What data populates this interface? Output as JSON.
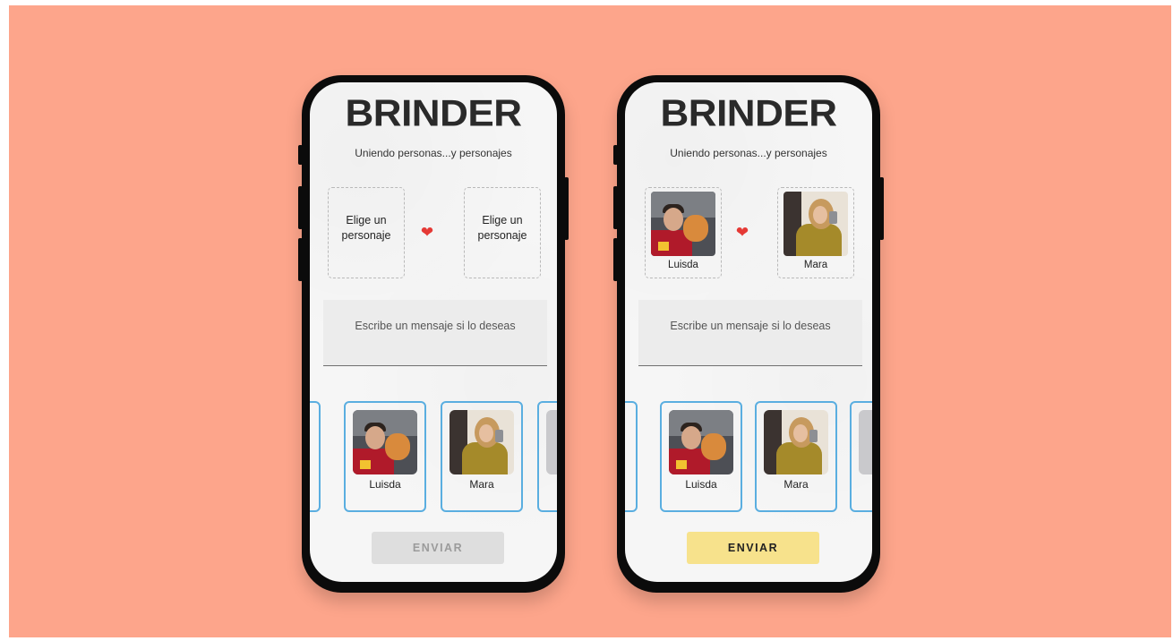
{
  "screens": [
    {
      "brand": "BRINDER",
      "tagline": "Uniendo personas...y personajes",
      "slot_left": {
        "text": "Elige un personaje",
        "name": "",
        "filled": false
      },
      "slot_right": {
        "text": "Elige un personaje",
        "name": "",
        "filled": false
      },
      "message_placeholder": "Escribe un mensaje si lo deseas",
      "cards": [
        {
          "name": "Luisda"
        },
        {
          "name": "Mara"
        }
      ],
      "send_label": "ENVIAR",
      "send_state": "disabled"
    },
    {
      "brand": "BRINDER",
      "tagline": "Uniendo personas...y personajes",
      "slot_left": {
        "text": "",
        "name": "Luisda",
        "filled": true
      },
      "slot_right": {
        "text": "",
        "name": "Mara",
        "filled": true
      },
      "message_placeholder": "Escribe un mensaje si lo deseas",
      "cards": [
        {
          "name": "Luisda"
        },
        {
          "name": "Mara"
        }
      ],
      "send_label": "ENVIAR",
      "send_state": "enabled"
    }
  ],
  "colors": {
    "background": "#fda58b",
    "card_border": "#5aaee0",
    "heart": "#e53935",
    "send_enabled": "#f7e28c",
    "send_disabled": "#dedede"
  }
}
